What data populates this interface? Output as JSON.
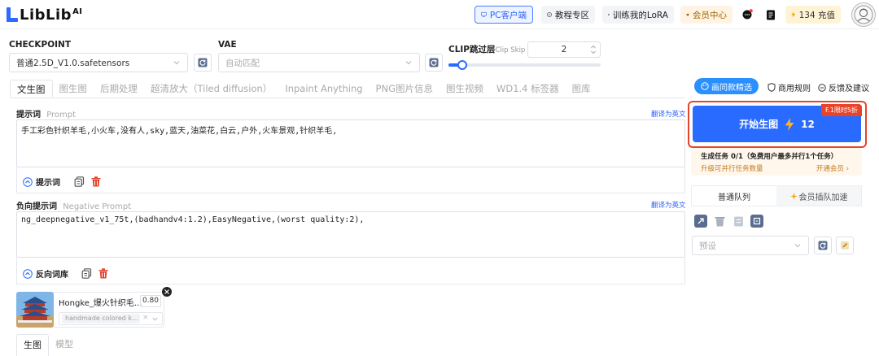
{
  "header": {
    "logo_text": "LibLib",
    "logo_sup": "AI",
    "pc_client": "PC客户端",
    "tutorial": "教程专区",
    "train_lora": "训练我的LoRA",
    "vip_center": "会员中心",
    "recharge": "134 充值"
  },
  "checkpoint": {
    "label": "CHECKPOINT",
    "value": "普通2.5D_V1.0.safetensors"
  },
  "vae": {
    "label": "VAE",
    "placeholder": "自动匹配"
  },
  "clip_skip": {
    "label": "CLIP跳过层",
    "sub": "Clip Skip",
    "value": "2",
    "slider_fraction": 0.08
  },
  "tabs": [
    "文生图",
    "图生图",
    "后期处理",
    "超清放大（Tiled diffusion）",
    "Inpaint Anything",
    "PNG图片信息",
    "图生视频",
    "WD1.4 标签器",
    "图库"
  ],
  "prompt": {
    "label": "提示词",
    "sub": "Prompt",
    "translate": "翻译为英文",
    "text": "手工彩色针织羊毛,小火车,没有人,sky,蓝天,油菜花,白云,户外,火车景观,针织羊毛,",
    "lib_label": "提示词"
  },
  "negative": {
    "label": "负向提示词",
    "sub": "Negative Prompt",
    "translate": "翻译为英文",
    "text": "ng_deepnegative_v1_75t,(badhandv4:1.2),EasyNegative,(worst quality:2),",
    "lib_label": "反向词库"
  },
  "lora": {
    "name": "Hongke_爆火针织毛...",
    "weight": "0.80",
    "tag": "handmade colored k..."
  },
  "bottom_tabs": [
    "生图",
    "模型"
  ],
  "right": {
    "featured": "画同款精选",
    "rules": "商用规则",
    "feedback": "反馈及建议",
    "generate": "开始生图",
    "cost": "12",
    "badge": "F.1限时5折",
    "task_title": "生成任务 0/1（免费用户最多并行1个任务）",
    "task_upgrade": "升级可并行任务数量",
    "task_link": "开通会员 ›",
    "queue_normal": "普通队列",
    "queue_vip": "会员插队加速",
    "preset_placeholder": "预设"
  },
  "colors": {
    "accent": "#2a6bff",
    "highlight_border": "#e4452c",
    "vip_bg": "#fff4e3"
  }
}
